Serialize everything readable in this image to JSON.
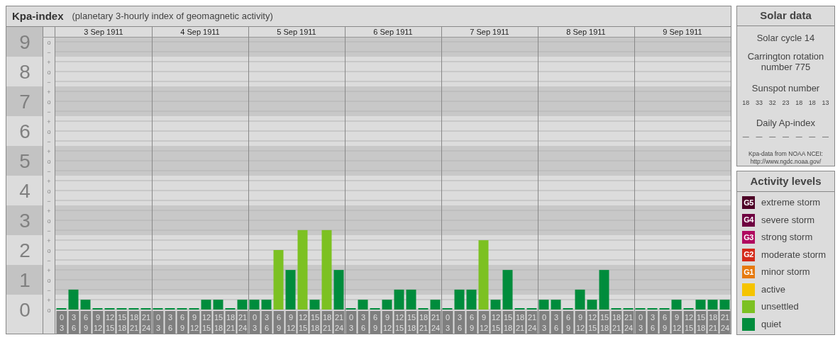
{
  "header": {
    "subtitle": "(planetary 3-hourly index of geomagnetic activity)"
  },
  "minor_ticks": [
    "o",
    "−",
    "+",
    "o",
    "−",
    "+",
    "o",
    "−",
    "+",
    "o",
    "−",
    "+",
    "o",
    "−",
    "+",
    "o",
    "−",
    "+",
    "o",
    "−",
    "+",
    "o",
    "−",
    "+",
    "o",
    "−",
    "+",
    "o"
  ],
  "days": [
    {
      "date": "3 Sep 1911",
      "intervals": [
        {
          "start": "0",
          "end": "3"
        },
        {
          "start": "3",
          "end": "6"
        },
        {
          "start": "6",
          "end": "9"
        },
        {
          "start": "9",
          "end": "12"
        },
        {
          "start": "12",
          "end": "15"
        },
        {
          "start": "15",
          "end": "18"
        },
        {
          "start": "18",
          "end": "21"
        },
        {
          "start": "21",
          "end": "24"
        }
      ]
    },
    {
      "date": "4 Sep 1911",
      "intervals": [
        {
          "start": "0",
          "end": "3"
        },
        {
          "start": "3",
          "end": "6"
        },
        {
          "start": "6",
          "end": "9"
        },
        {
          "start": "9",
          "end": "12"
        },
        {
          "start": "12",
          "end": "15"
        },
        {
          "start": "15",
          "end": "18"
        },
        {
          "start": "18",
          "end": "21"
        },
        {
          "start": "21",
          "end": "24"
        }
      ]
    },
    {
      "date": "5 Sep 1911",
      "intervals": [
        {
          "start": "0",
          "end": "3"
        },
        {
          "start": "3",
          "end": "6"
        },
        {
          "start": "6",
          "end": "9"
        },
        {
          "start": "9",
          "end": "12"
        },
        {
          "start": "12",
          "end": "15"
        },
        {
          "start": "15",
          "end": "18"
        },
        {
          "start": "18",
          "end": "21"
        },
        {
          "start": "21",
          "end": "24"
        }
      ]
    },
    {
      "date": "6 Sep 1911",
      "intervals": [
        {
          "start": "0",
          "end": "3"
        },
        {
          "start": "3",
          "end": "6"
        },
        {
          "start": "6",
          "end": "9"
        },
        {
          "start": "9",
          "end": "12"
        },
        {
          "start": "12",
          "end": "15"
        },
        {
          "start": "15",
          "end": "18"
        },
        {
          "start": "18",
          "end": "21"
        },
        {
          "start": "21",
          "end": "24"
        }
      ]
    },
    {
      "date": "7 Sep 1911",
      "intervals": [
        {
          "start": "0",
          "end": "3"
        },
        {
          "start": "3",
          "end": "6"
        },
        {
          "start": "6",
          "end": "9"
        },
        {
          "start": "9",
          "end": "12"
        },
        {
          "start": "12",
          "end": "15"
        },
        {
          "start": "15",
          "end": "18"
        },
        {
          "start": "18",
          "end": "21"
        },
        {
          "start": "21",
          "end": "24"
        }
      ]
    },
    {
      "date": "8 Sep 1911",
      "intervals": [
        {
          "start": "0",
          "end": "3"
        },
        {
          "start": "3",
          "end": "6"
        },
        {
          "start": "6",
          "end": "9"
        },
        {
          "start": "9",
          "end": "12"
        },
        {
          "start": "12",
          "end": "15"
        },
        {
          "start": "15",
          "end": "18"
        },
        {
          "start": "18",
          "end": "21"
        },
        {
          "start": "21",
          "end": "24"
        }
      ]
    },
    {
      "date": "9 Sep 1911",
      "intervals": [
        {
          "start": "0",
          "end": "3"
        },
        {
          "start": "3",
          "end": "6"
        },
        {
          "start": "6",
          "end": "9"
        },
        {
          "start": "9",
          "end": "12"
        },
        {
          "start": "12",
          "end": "15"
        },
        {
          "start": "15",
          "end": "18"
        },
        {
          "start": "18",
          "end": "21"
        },
        {
          "start": "21",
          "end": "24"
        }
      ]
    }
  ],
  "chart_data": {
    "type": "bar",
    "title": "Kpa-index",
    "ylim": [
      0,
      9
    ],
    "grid": true,
    "bands": [
      {
        "axis": "y",
        "from": 0.5,
        "to": 1.5
      },
      {
        "axis": "y",
        "from": 2.5,
        "to": 3.5
      },
      {
        "axis": "y",
        "from": 4.5,
        "to": 5.5
      },
      {
        "axis": "y",
        "from": 6.5,
        "to": 7.5
      },
      {
        "axis": "y",
        "from": 8.5,
        "to": 9.17
      }
    ],
    "yticks": [
      {
        "value": 9,
        "label": "9"
      },
      {
        "value": 8,
        "label": "8"
      },
      {
        "value": 7,
        "label": "7"
      },
      {
        "value": 6,
        "label": "6"
      },
      {
        "value": 5,
        "label": "5"
      },
      {
        "value": 4,
        "label": "4"
      },
      {
        "value": 3,
        "label": "3"
      },
      {
        "value": 2,
        "label": "2"
      },
      {
        "value": 1,
        "label": "1"
      },
      {
        "value": 0,
        "label": "0"
      }
    ],
    "series": [
      {
        "color": "#008c3c",
        "values": [
          0,
          0.67,
          0.33,
          0,
          0,
          0,
          0,
          0,
          0,
          0,
          0,
          0,
          0.33,
          0.33,
          0,
          0.33,
          0.33,
          0.33,
          null,
          1.33,
          null,
          0.33,
          null,
          1.33,
          0,
          0.33,
          0,
          0.33,
          0.67,
          0.67,
          0,
          0.33,
          0,
          0.67,
          0.67,
          null,
          0.33,
          1.33,
          0,
          0,
          0.33,
          0.33,
          0,
          0.67,
          0.33,
          1.33,
          0,
          0,
          0,
          0,
          0,
          0.33,
          0,
          0.33,
          0.33,
          0.33
        ]
      },
      {
        "color": "#7cc122",
        "values": [
          null,
          null,
          null,
          null,
          null,
          null,
          null,
          null,
          null,
          null,
          null,
          null,
          null,
          null,
          null,
          null,
          null,
          null,
          2,
          null,
          2.67,
          null,
          2.67,
          null,
          null,
          null,
          null,
          null,
          null,
          null,
          null,
          null,
          null,
          null,
          null,
          2.33,
          null,
          null,
          null,
          null,
          null,
          null,
          null,
          null,
          null,
          null,
          null,
          null,
          null,
          null,
          null,
          null,
          null,
          null,
          null,
          null
        ]
      }
    ]
  },
  "solar": {
    "title": "Solar data",
    "cycle": "Solar cycle 14",
    "rotation": "Carrington rotation number 775",
    "sunspot_label": "Sunspot number",
    "sunspots": [
      "18",
      "33",
      "32",
      "23",
      "18",
      "18",
      "13"
    ],
    "ap_label": "Daily Ap-index",
    "ap_values": [
      "—",
      "—",
      "—",
      "—",
      "—",
      "—",
      "—"
    ],
    "note": "Kpa-data from NOAA NCEI: http://www.ngdc.noaa.gov/"
  },
  "activity_levels": {
    "title": "Activity levels",
    "items": [
      {
        "badge": "G5",
        "label": "extreme storm",
        "color": "#4d0026"
      },
      {
        "badge": "G4",
        "label": "severe storm",
        "color": "#6e0040"
      },
      {
        "badge": "G3",
        "label": "strong storm",
        "color": "#b0085f"
      },
      {
        "badge": "G2",
        "label": "moderate storm",
        "color": "#d42a1a"
      },
      {
        "badge": "G1",
        "label": "minor storm",
        "color": "#e67a0f"
      },
      {
        "label": "active",
        "color": "#f5c400"
      },
      {
        "label": "unsettled",
        "color": "#7cc122"
      },
      {
        "label": "quiet",
        "color": "#008c3c"
      }
    ]
  }
}
